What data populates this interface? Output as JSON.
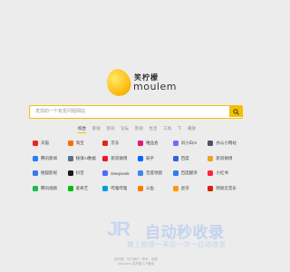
{
  "logo": {
    "cn": "笑柠檬",
    "en": "moulem"
  },
  "search": {
    "placeholder": "发现的一个有爱问题网站",
    "button_icon": "search-icon"
  },
  "tabs": [
    {
      "label": "综合",
      "active": true
    },
    {
      "label": "影视"
    },
    {
      "label": "资讯"
    },
    {
      "label": "论坛"
    },
    {
      "label": "影视"
    },
    {
      "label": "生活"
    },
    {
      "label": "工具"
    },
    {
      "label": "下"
    },
    {
      "label": "播放"
    }
  ],
  "sites": [
    {
      "name": "天猫",
      "color": "#e8281d"
    },
    {
      "name": "淘宝",
      "color": "#ff6a00"
    },
    {
      "name": "京东",
      "color": "#e1251b"
    },
    {
      "name": "唯品会",
      "color": "#e5187a"
    },
    {
      "name": "问小白AI",
      "color": "#6f6bff"
    },
    {
      "name": "办公小网站",
      "color": "#4a5565"
    },
    {
      "name": "腾讯新闻",
      "color": "#2a7ef4"
    },
    {
      "name": "秘境AI数据",
      "color": "#5b6f8a"
    },
    {
      "name": "新浪微博",
      "color": "#e6162d"
    },
    {
      "name": "知乎",
      "color": "#0066ff"
    },
    {
      "name": "百度",
      "color": "#3166d6"
    },
    {
      "name": "新浪微博",
      "color": "#f0a020"
    },
    {
      "name": "搜狐影视",
      "color": "#3a78e8"
    },
    {
      "name": "抖音",
      "color": "#1a1a1a"
    },
    {
      "name": "Deepseek",
      "color": "#4d6bfe"
    },
    {
      "name": "百度地图",
      "color": "#3a8bf0"
    },
    {
      "name": "百度翻译",
      "color": "#2d7cf3"
    },
    {
      "name": "小红书",
      "color": "#ff2442"
    },
    {
      "name": "腾讯视频",
      "color": "#1db954"
    },
    {
      "name": "爱奇艺",
      "color": "#00be06"
    },
    {
      "name": "哔哩哔哩",
      "color": "#00a1d6"
    },
    {
      "name": "斗鱼",
      "color": "#ff7a00"
    },
    {
      "name": "虎牙",
      "color": "#ff9a00"
    },
    {
      "name": "网易云音乐",
      "color": "#d81e06"
    }
  ],
  "watermark": {
    "logo": "JR",
    "title": "自动秒收录",
    "subtitle": "做上链接一来访一次一自动收录"
  },
  "footer": {
    "line1": "笑柠檬 · 关于我们 · 联系 · 投稿",
    "line2": "©moulem 笑柠檬 ICP备案"
  }
}
